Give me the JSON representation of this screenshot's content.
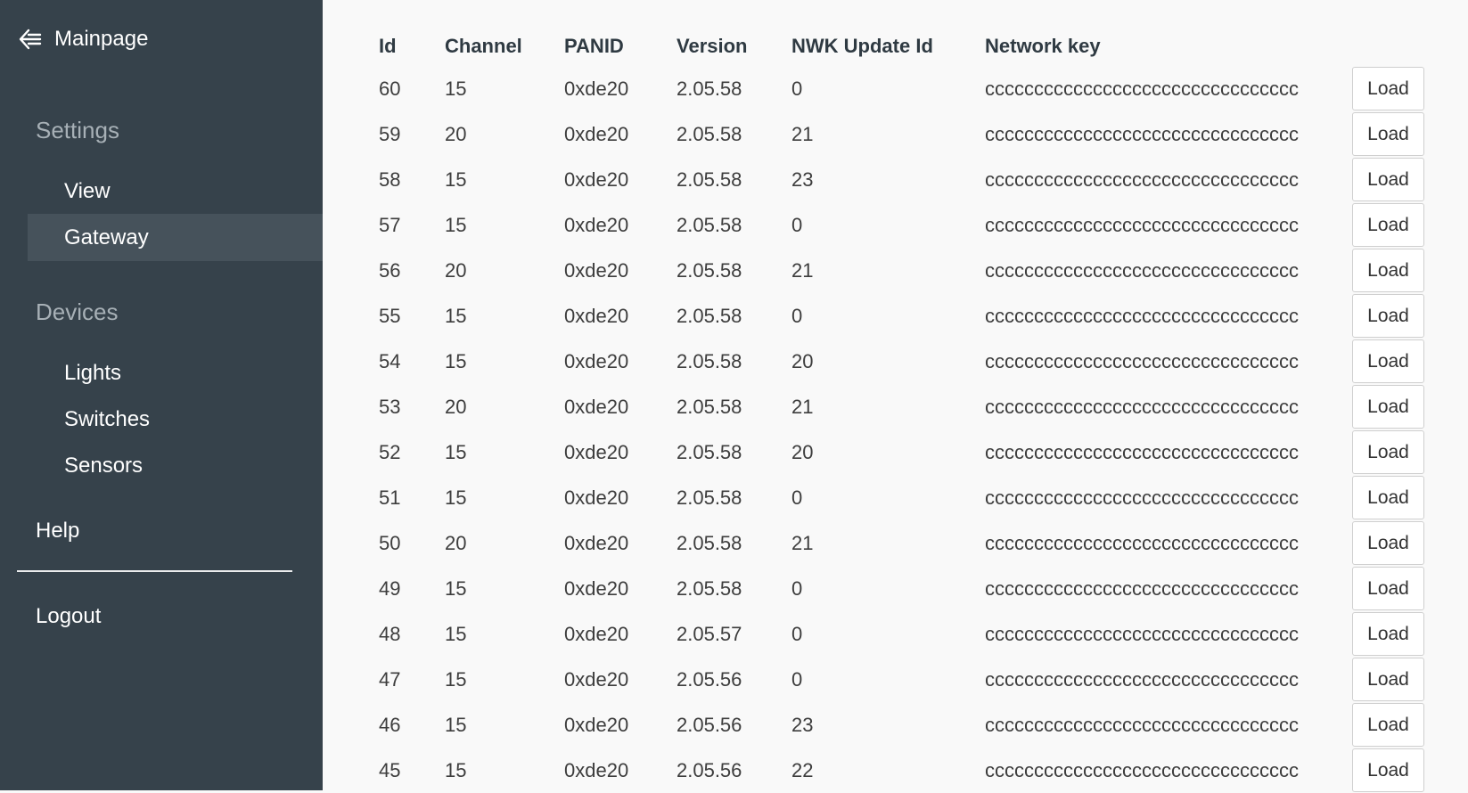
{
  "sidebar": {
    "back_label": "Mainpage",
    "back_icon": "arrow-left-icon",
    "settings_title": "Settings",
    "settings_items": [
      {
        "label": "View",
        "active": false
      },
      {
        "label": "Gateway",
        "active": true
      }
    ],
    "devices_title": "Devices",
    "device_items": [
      {
        "label": "Lights"
      },
      {
        "label": "Switches"
      },
      {
        "label": "Sensors"
      }
    ],
    "help_label": "Help",
    "logout_label": "Logout"
  },
  "table": {
    "headers": [
      "Id",
      "Channel",
      "PANID",
      "Version",
      "NWK Update Id",
      "Network key",
      ""
    ],
    "load_label": "Load",
    "rows": [
      {
        "id": "60",
        "channel": "15",
        "panid": "0xde20",
        "version": "2.05.58",
        "nwk": "0",
        "key": "cccccccccccccccccccccccccccccccc"
      },
      {
        "id": "59",
        "channel": "20",
        "panid": "0xde20",
        "version": "2.05.58",
        "nwk": "21",
        "key": "cccccccccccccccccccccccccccccccc"
      },
      {
        "id": "58",
        "channel": "15",
        "panid": "0xde20",
        "version": "2.05.58",
        "nwk": "23",
        "key": "cccccccccccccccccccccccccccccccc"
      },
      {
        "id": "57",
        "channel": "15",
        "panid": "0xde20",
        "version": "2.05.58",
        "nwk": "0",
        "key": "cccccccccccccccccccccccccccccccc"
      },
      {
        "id": "56",
        "channel": "20",
        "panid": "0xde20",
        "version": "2.05.58",
        "nwk": "21",
        "key": "cccccccccccccccccccccccccccccccc"
      },
      {
        "id": "55",
        "channel": "15",
        "panid": "0xde20",
        "version": "2.05.58",
        "nwk": "0",
        "key": "cccccccccccccccccccccccccccccccc"
      },
      {
        "id": "54",
        "channel": "15",
        "panid": "0xde20",
        "version": "2.05.58",
        "nwk": "20",
        "key": "cccccccccccccccccccccccccccccccc"
      },
      {
        "id": "53",
        "channel": "20",
        "panid": "0xde20",
        "version": "2.05.58",
        "nwk": "21",
        "key": "cccccccccccccccccccccccccccccccc"
      },
      {
        "id": "52",
        "channel": "15",
        "panid": "0xde20",
        "version": "2.05.58",
        "nwk": "20",
        "key": "cccccccccccccccccccccccccccccccc"
      },
      {
        "id": "51",
        "channel": "15",
        "panid": "0xde20",
        "version": "2.05.58",
        "nwk": "0",
        "key": "cccccccccccccccccccccccccccccccc"
      },
      {
        "id": "50",
        "channel": "20",
        "panid": "0xde20",
        "version": "2.05.58",
        "nwk": "21",
        "key": "cccccccccccccccccccccccccccccccc"
      },
      {
        "id": "49",
        "channel": "15",
        "panid": "0xde20",
        "version": "2.05.58",
        "nwk": "0",
        "key": "cccccccccccccccccccccccccccccccc"
      },
      {
        "id": "48",
        "channel": "15",
        "panid": "0xde20",
        "version": "2.05.57",
        "nwk": "0",
        "key": "cccccccccccccccccccccccccccccccc"
      },
      {
        "id": "47",
        "channel": "15",
        "panid": "0xde20",
        "version": "2.05.56",
        "nwk": "0",
        "key": "cccccccccccccccccccccccccccccccc"
      },
      {
        "id": "46",
        "channel": "15",
        "panid": "0xde20",
        "version": "2.05.56",
        "nwk": "23",
        "key": "cccccccccccccccccccccccccccccccc"
      },
      {
        "id": "45",
        "channel": "15",
        "panid": "0xde20",
        "version": "2.05.56",
        "nwk": "22",
        "key": "cccccccccccccccccccccccccccccccc"
      }
    ]
  },
  "colors": {
    "sidebar_bg": "#36424b",
    "sidebar_active_bg": "#46525b",
    "section_title": "#a7b0b6",
    "main_bg": "#f9f9f9"
  }
}
